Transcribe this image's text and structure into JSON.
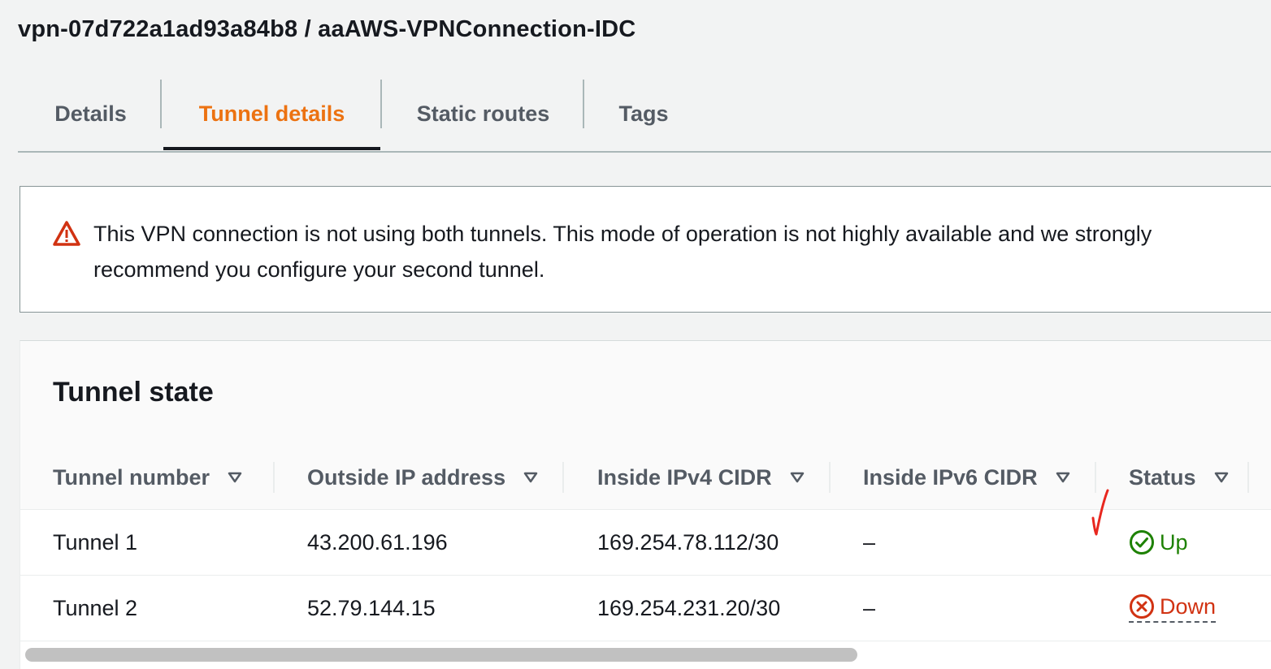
{
  "page": {
    "title": "vpn-07d722a1ad93a84b8 / aaAWS-VPNConnection-IDC"
  },
  "tabs": [
    {
      "label": "Details",
      "active": false
    },
    {
      "label": "Tunnel details",
      "active": true
    },
    {
      "label": "Static routes",
      "active": false
    },
    {
      "label": "Tags",
      "active": false
    }
  ],
  "alert": {
    "icon": "warning-icon",
    "text": "This VPN connection is not using both tunnels. This mode of operation is not highly available and we strongly recommend you configure your second tunnel."
  },
  "tunnel_state": {
    "title": "Tunnel state",
    "columns": [
      "Tunnel number",
      "Outside IP address",
      "Inside IPv4 CIDR",
      "Inside IPv6 CIDR",
      "Status"
    ],
    "rows": [
      {
        "tunnel": "Tunnel 1",
        "outside_ip": "43.200.61.196",
        "inside_ipv4": "169.254.78.112/30",
        "inside_ipv6": "–",
        "status": "Up"
      },
      {
        "tunnel": "Tunnel 2",
        "outside_ip": "52.79.144.15",
        "inside_ipv4": "169.254.231.20/30",
        "inside_ipv6": "–",
        "status": "Down"
      }
    ]
  },
  "colors": {
    "accent": "#ec7211",
    "status_up": "#1d8102",
    "status_down": "#d13212",
    "annotation": "#e8271f"
  }
}
